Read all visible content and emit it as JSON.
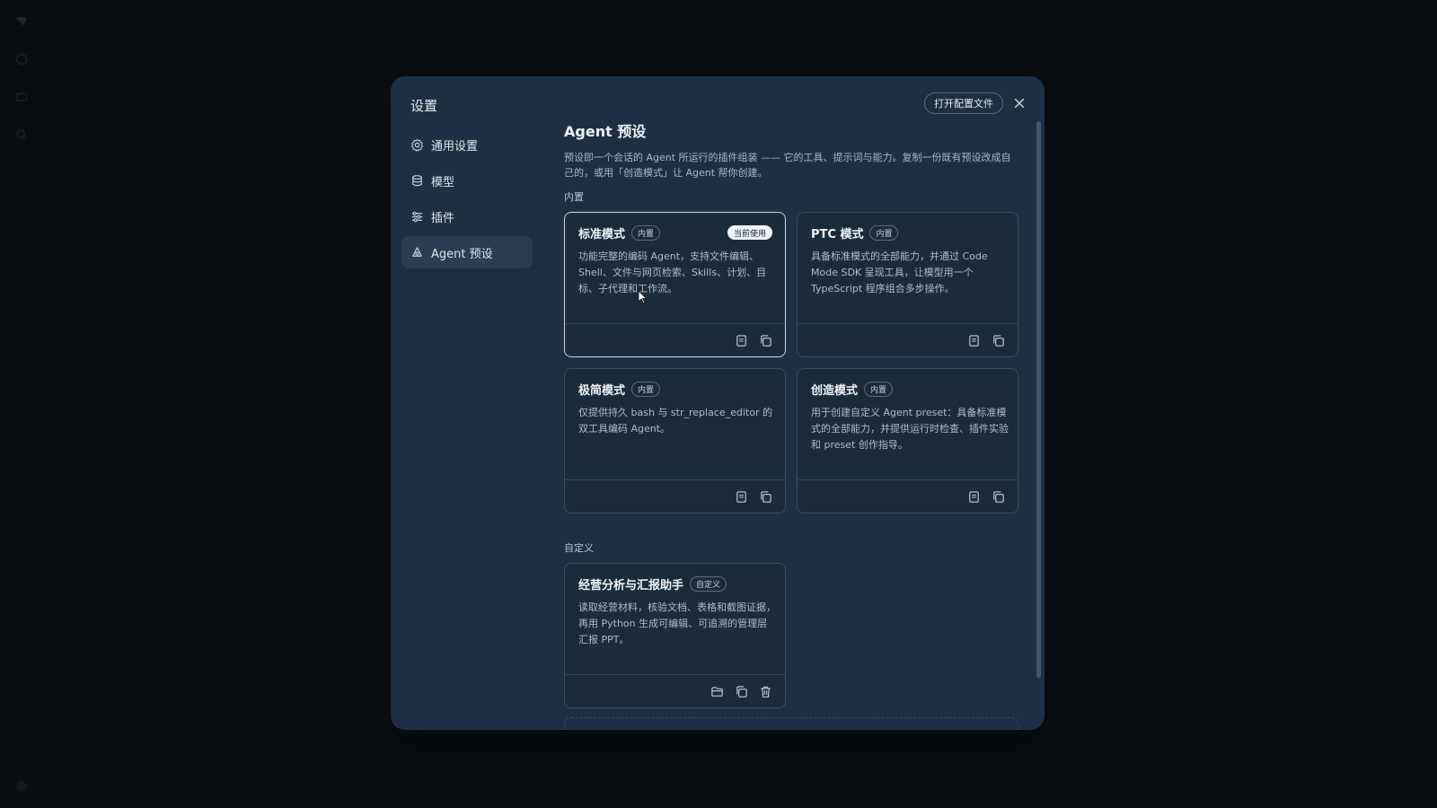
{
  "app_rail": {
    "icons": [
      "logo-icon",
      "history-icon",
      "folder-icon",
      "search-icon",
      "account-icon"
    ]
  },
  "modal": {
    "title": "设置",
    "open_config_label": "打开配置文件",
    "close_icon": "close-icon"
  },
  "sidebar": {
    "items": [
      {
        "label": "通用设置",
        "icon": "gear-icon",
        "active": false
      },
      {
        "label": "模型",
        "icon": "database-icon",
        "active": false
      },
      {
        "label": "插件",
        "icon": "sliders-icon",
        "active": false
      },
      {
        "label": "Agent 预设",
        "icon": "agent-icon",
        "active": true
      }
    ]
  },
  "main": {
    "title": "Agent 预设",
    "description": "预设即一个会话的 Agent 所运行的插件组装 —— 它的工具、提示词与能力。复制一份既有预设改成自己的，或用「创造模式」让 Agent 帮你创建。",
    "builtin_section": "内置",
    "custom_section": "自定义",
    "current_badge": "当前使用",
    "builtin_cards": [
      {
        "name": "标准模式",
        "badge": "内置",
        "description": "功能完整的编码 Agent，支持文件编辑、Shell、文件与网页检索、Skills、计划、目标、子代理和工作流。",
        "current": true
      },
      {
        "name": "PTC 模式",
        "badge": "内置",
        "description": "具备标准模式的全部能力，并通过 Code Mode SDK 呈现工具，让模型用一个 TypeScript 程序组合多步操作。",
        "current": false
      },
      {
        "name": "极简模式",
        "badge": "内置",
        "description": "仅提供持久 bash 与 str_replace_editor 的双工具编码 Agent。",
        "current": false
      },
      {
        "name": "创造模式",
        "badge": "内置",
        "description": "用于创建自定义 Agent preset：具备标准模式的全部能力，并提供运行时检查、插件实验和 preset 创作指导。",
        "current": false
      }
    ],
    "custom_cards": [
      {
        "name": "经营分析与汇报助手",
        "badge": "自定义",
        "description": "读取经营材料，核验文档、表格和截图证据，再用 Python 生成可编辑、可追溯的管理层汇报 PPT。"
      }
    ]
  }
}
